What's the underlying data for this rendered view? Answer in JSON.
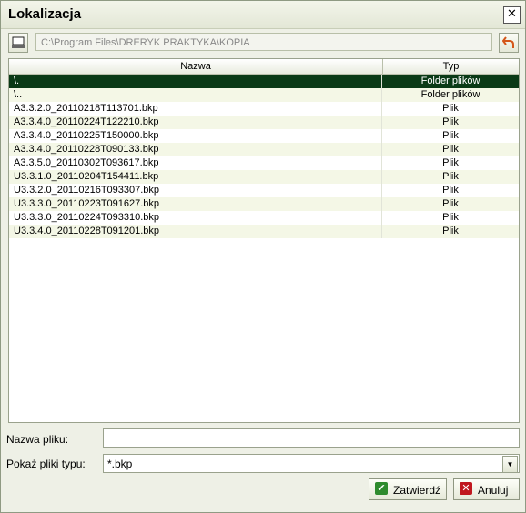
{
  "window": {
    "title": "Lokalizacja"
  },
  "toolbar": {
    "path": "C:\\Program Files\\DRERYK PRAKTYKA\\KOPIA"
  },
  "list": {
    "col_name": "Nazwa",
    "col_type": "Typ",
    "rows": [
      {
        "name": "\\.",
        "type": "Folder plików"
      },
      {
        "name": "\\..",
        "type": "Folder plików"
      },
      {
        "name": "A3.3.2.0_20110218T113701.bkp",
        "type": "Plik"
      },
      {
        "name": "A3.3.4.0_20110224T122210.bkp",
        "type": "Plik"
      },
      {
        "name": "A3.3.4.0_20110225T150000.bkp",
        "type": "Plik"
      },
      {
        "name": "A3.3.4.0_20110228T090133.bkp",
        "type": "Plik"
      },
      {
        "name": "A3.3.5.0_20110302T093617.bkp",
        "type": "Plik"
      },
      {
        "name": "U3.3.1.0_20110204T154411.bkp",
        "type": "Plik"
      },
      {
        "name": "U3.3.2.0_20110216T093307.bkp",
        "type": "Plik"
      },
      {
        "name": "U3.3.3.0_20110223T091627.bkp",
        "type": "Plik"
      },
      {
        "name": "U3.3.3.0_20110224T093310.bkp",
        "type": "Plik"
      },
      {
        "name": "U3.3.4.0_20110228T091201.bkp",
        "type": "Plik"
      }
    ]
  },
  "form": {
    "filename_label": "Nazwa pliku:",
    "filename_value": "",
    "filetype_label": "Pokaż pliki typu:",
    "filetype_value": "*.bkp"
  },
  "buttons": {
    "ok": "Zatwierdź",
    "cancel": "Anuluj"
  }
}
